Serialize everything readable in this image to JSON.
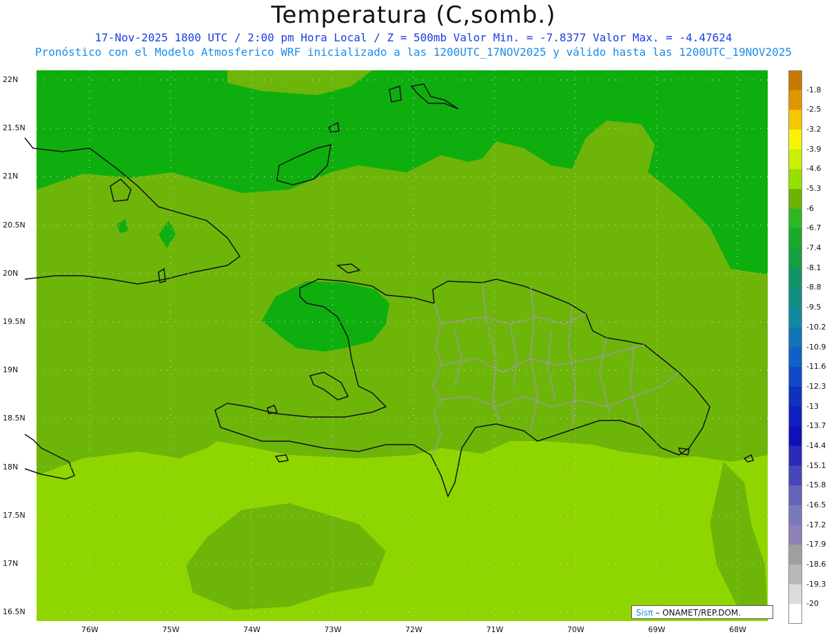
{
  "header": {
    "title": "Temperatura (C,somb.)",
    "subtitle_1": "17-Nov-2025  1800 UTC / 2:00 pm Hora Local / Z = 500mb   Valor Min. = -7.8377  Valor Max. = -4.47624",
    "subtitle_2": "Pronóstico con el Modelo Atmosferico WRF inicializado a las 1200UTC_17NOV2025 y válido hasta las  1200UTC_19NOV2025"
  },
  "map": {
    "lat_labels": [
      "22N",
      "21.5N",
      "21N",
      "20.5N",
      "20N",
      "19.5N",
      "19N",
      "18.5N",
      "18N",
      "17.5N",
      "17N",
      "16.5N"
    ],
    "lon_labels": [
      "76W",
      "75W",
      "74W",
      "73W",
      "72W",
      "71W",
      "70W",
      "69W",
      "68W"
    ],
    "fill_colors": {
      "band_dark": "#0fae0f",
      "band_mid": "#6eb50a",
      "band_light": "#8fd600",
      "coast": "#111111",
      "provinces": "#9a9a9a"
    }
  },
  "colorbar": {
    "labels": [
      "-1.8",
      "-2.5",
      "-3.2",
      "-3.9",
      "-4.6",
      "-5.3",
      "-6",
      "-6.7",
      "-7.4",
      "-8.1",
      "-8.8",
      "-9.5",
      "-10.2",
      "-10.9",
      "-11.6",
      "-12.3",
      "-13",
      "-13.7",
      "-14.4",
      "-15.1",
      "-15.8",
      "-16.5",
      "-17.2",
      "-17.9",
      "-18.6",
      "-19.3",
      "-20"
    ],
    "colors": [
      "#c87800",
      "#e09600",
      "#f6c800",
      "#f8f400",
      "#c8f000",
      "#96e000",
      "#6cb400",
      "#2cb824",
      "#18aa28",
      "#12a040",
      "#10946a",
      "#109080",
      "#108aa0",
      "#1074b8",
      "#1060c8",
      "#1048c8",
      "#1030c0",
      "#1020c0",
      "#1010b8",
      "#2a2ab8",
      "#4646b8",
      "#6464b8",
      "#7a7ab8",
      "#9080b8",
      "#a0a0a0",
      "#b8b8b8",
      "#dcdcdc",
      "#ffffff"
    ]
  },
  "credit": {
    "brand": "Sisπ",
    "text": " – ONAMET/REP.DOM."
  }
}
